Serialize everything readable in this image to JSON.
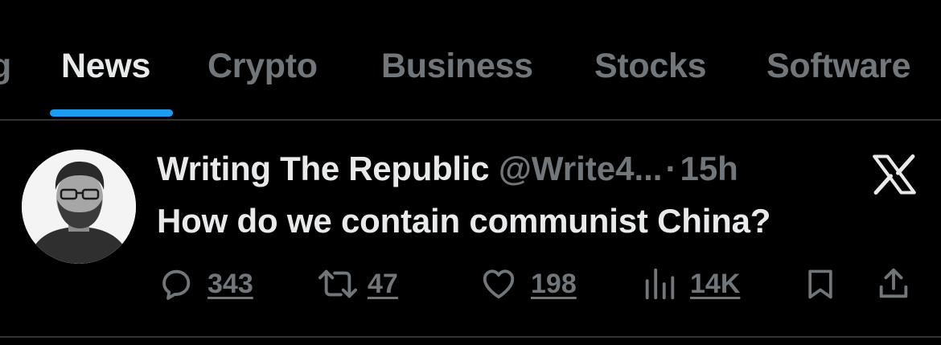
{
  "tabs": [
    {
      "label": "g",
      "active": false
    },
    {
      "label": "News",
      "active": true
    },
    {
      "label": "Crypto",
      "active": false
    },
    {
      "label": "Business",
      "active": false
    },
    {
      "label": "Stocks",
      "active": false
    },
    {
      "label": "Software",
      "active": false
    }
  ],
  "tweet": {
    "author_name": "Writing The Republic",
    "author_handle": "@Write4...",
    "separator": "·",
    "time": "15h",
    "text": "How do we contain communist China?",
    "avatar": "avatar-man-with-glasses-and-beard",
    "source_logo": "x-logo",
    "actions": {
      "replies": {
        "icon": "reply-icon",
        "count": "343"
      },
      "reposts": {
        "icon": "repost-icon",
        "count": "47"
      },
      "likes": {
        "icon": "heart-icon",
        "count": "198"
      },
      "views": {
        "icon": "views-icon",
        "count": "14K"
      },
      "bookmark": {
        "icon": "bookmark-icon"
      },
      "share": {
        "icon": "share-icon"
      }
    }
  },
  "colors": {
    "background": "#000000",
    "primary_text": "#e7e9ea",
    "secondary_text": "#71767b",
    "accent": "#1d9bf0",
    "divider": "#2f3336"
  }
}
